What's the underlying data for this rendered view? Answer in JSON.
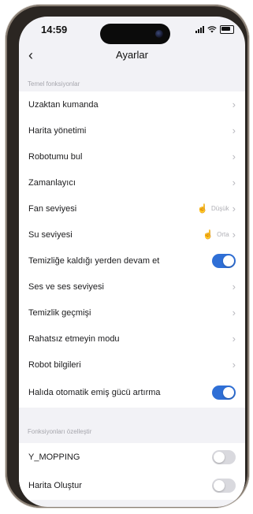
{
  "status": {
    "time": "14:59"
  },
  "nav": {
    "title": "Ayarlar"
  },
  "sections": {
    "basic": "Temel fonksiyonlar",
    "custom": "Fonksiyonları özelleştir"
  },
  "rows": [
    {
      "label": "Uzaktan kumanda",
      "type": "chevron"
    },
    {
      "label": "Harita yönetimi",
      "type": "chevron"
    },
    {
      "label": "Robotumu bul",
      "type": "chevron"
    },
    {
      "label": "Zamanlayıcı",
      "type": "chevron"
    },
    {
      "label": "Fan seviyesi",
      "value": "Düşük",
      "type": "chevron"
    },
    {
      "label": "Su seviyesi",
      "value": "Orta",
      "type": "chevron"
    },
    {
      "label": "Temizliğe kaldığı yerden devam et",
      "type": "toggle",
      "on": true
    },
    {
      "label": "Ses ve ses seviyesi",
      "type": "chevron"
    },
    {
      "label": "Temizlik geçmişi",
      "type": "chevron"
    },
    {
      "label": "Rahatsız etmeyin modu",
      "type": "chevron"
    },
    {
      "label": "Robot bilgileri",
      "type": "chevron"
    },
    {
      "label": "Halıda otomatik emiş gücü artırma",
      "type": "toggle",
      "on": true
    },
    {
      "label": "Y_MOPPING",
      "type": "toggle",
      "on": false
    },
    {
      "label": "Harita Oluştur",
      "type": "toggle",
      "on": false
    }
  ],
  "icons": {
    "back": "chevron-left-icon",
    "chevron": "chevron-right-icon",
    "tap": "hand-tap-icon"
  },
  "colors": {
    "toggle_on": "#2f6fd6",
    "toggle_off": "#d9d9de",
    "tap_hint": "#d63b2f"
  }
}
